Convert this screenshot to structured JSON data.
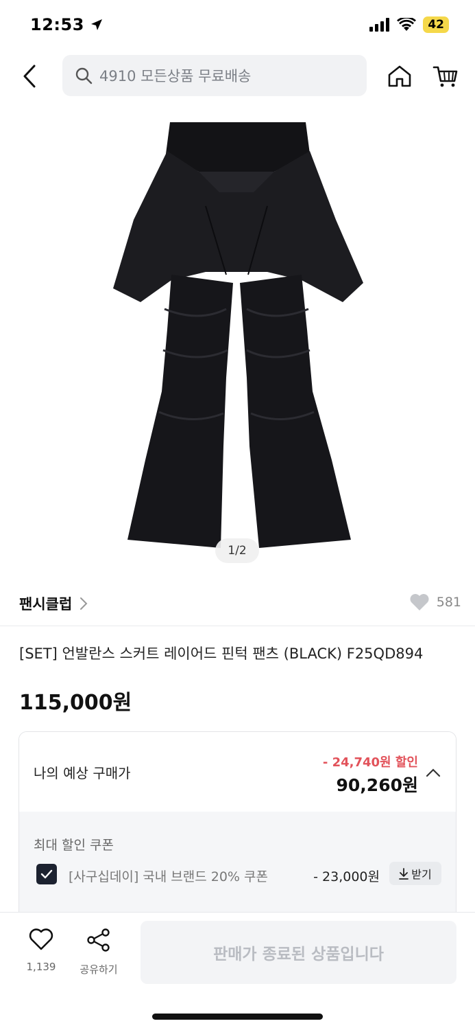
{
  "status_bar": {
    "time": "12:53",
    "battery": "42",
    "icons": [
      "location-arrow-icon",
      "signal-icon",
      "wifi-icon"
    ]
  },
  "header": {
    "search_placeholder": "4910 모든상품 무료배송",
    "icons": [
      "back-icon",
      "search-icon",
      "home-icon",
      "cart-icon"
    ]
  },
  "gallery": {
    "page_indicator": "1/2"
  },
  "brand": {
    "name": "팬시클럽",
    "like_count": "581"
  },
  "product": {
    "title": "[SET] 언발란스 스커트 레이어드 핀턱 팬츠 (BLACK) F25QD894",
    "price": "115,000원"
  },
  "purchase": {
    "label": "나의 예상 구매가",
    "discount": "- 24,740원 할인",
    "final_price": "90,260원",
    "coupon_heading": "최대 할인 쿠폰",
    "coupon": {
      "name": "[사구십데이] 국내 브랜드 20% 쿠폰",
      "value": "- 23,000원",
      "download_label": "받기",
      "checked": true
    }
  },
  "bottom_bar": {
    "wish_count": "1,139",
    "share_label": "공유하기",
    "cta_label": "판매가 종료된 상품입니다"
  },
  "colors": {
    "discount": "#e2525a",
    "checkbox": "#1c2230",
    "battery": "#f5d84a"
  }
}
